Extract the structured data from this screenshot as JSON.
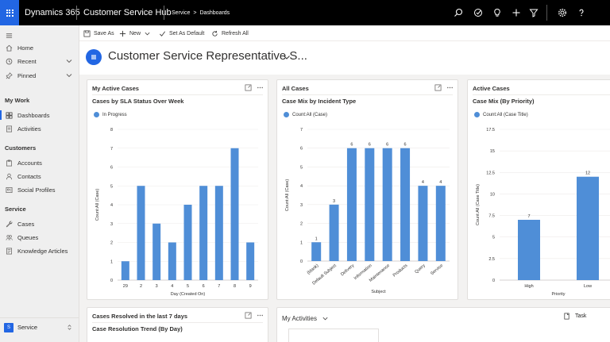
{
  "topbar": {
    "brand": "Dynamics 365",
    "app_title": "Customer Service Hub",
    "breadcrumb": [
      "Service",
      "Dashboards"
    ],
    "icons": [
      "search-icon",
      "task-icon",
      "lightbulb-icon",
      "plus-icon",
      "filter-icon",
      "gear-icon",
      "help-icon"
    ]
  },
  "sidebar": {
    "items_top": [
      {
        "label": "Home",
        "icon": "home-icon"
      },
      {
        "label": "Recent",
        "icon": "clock-icon"
      },
      {
        "label": "Pinned",
        "icon": "pin-icon"
      }
    ],
    "groups": [
      {
        "title": "My Work",
        "items": [
          {
            "label": "Dashboards",
            "icon": "dashboard-icon"
          },
          {
            "label": "Activities",
            "icon": "activities-icon"
          }
        ]
      },
      {
        "title": "Customers",
        "items": [
          {
            "label": "Accounts",
            "icon": "accounts-icon"
          },
          {
            "label": "Contacts",
            "icon": "contact-icon"
          },
          {
            "label": "Social Profiles",
            "icon": "social-icon"
          }
        ]
      },
      {
        "title": "Service",
        "items": [
          {
            "label": "Cases",
            "icon": "wrench-icon"
          },
          {
            "label": "Queues",
            "icon": "queue-icon"
          },
          {
            "label": "Knowledge Articles",
            "icon": "article-icon"
          }
        ]
      }
    ],
    "area": {
      "badge": "S",
      "label": "Service"
    }
  },
  "commands": {
    "save_as": "Save As",
    "new": "New",
    "set_default": "Set As Default",
    "refresh": "Refresh All"
  },
  "dashboard": {
    "title": "Customer Service Representative S..."
  },
  "cards": {
    "c1": {
      "title": "My Active Cases",
      "subtitle": "Cases by SLA Status Over Week",
      "legend": "In Progress"
    },
    "c2": {
      "title": "All Cases",
      "subtitle": "Case Mix by Incident Type",
      "legend": "Count:All (Case)"
    },
    "c3": {
      "title": "Active Cases",
      "subtitle": "Case Mix (By Priority)",
      "legend": "Count:All (Case Title)"
    },
    "c4": {
      "title": "Cases Resolved in the last 7 days",
      "subtitle": "Case Resolution Trend (By Day)"
    },
    "c5": {
      "title": "My Activities",
      "task_label": "Task"
    }
  },
  "colors": {
    "accent": "#2266e3",
    "bar": "#4f8ed7"
  },
  "chart_data": [
    {
      "type": "bar",
      "categories": [
        "29",
        "2",
        "3",
        "4",
        "5",
        "6",
        "7",
        "8",
        "9"
      ],
      "values": [
        1,
        5,
        3,
        2,
        4,
        5,
        5,
        7,
        2
      ],
      "xlabel": "Day (Created On)",
      "ylabel": "Count:All (Case)",
      "ylim": [
        0,
        8
      ],
      "yticks": [
        0,
        1,
        2,
        3,
        4,
        5,
        6,
        7,
        8
      ],
      "legend": "In Progress",
      "data_labels": false
    },
    {
      "type": "bar",
      "categories": [
        "(blank)",
        "Default Subject",
        "Delivery",
        "Information",
        "Maintenance",
        "Products",
        "Query",
        "Service"
      ],
      "values": [
        1,
        3,
        6,
        6,
        6,
        6,
        4,
        4
      ],
      "xlabel": "Subject",
      "ylabel": "Count:All (Case)",
      "ylim": [
        0,
        7
      ],
      "yticks": [
        0,
        1,
        2,
        3,
        4,
        5,
        6,
        7
      ],
      "legend": "Count:All (Case)",
      "data_labels": true
    },
    {
      "type": "bar",
      "categories": [
        "High",
        "Low"
      ],
      "values": [
        7,
        12
      ],
      "xlabel": "Priority",
      "ylabel": "Count:All (Case Title)",
      "ylim": [
        0,
        17.5
      ],
      "yticks": [
        0,
        2.5,
        5,
        7.5,
        10,
        12.5,
        15,
        17.5
      ],
      "legend": "Count:All (Case Title)",
      "data_labels": true
    }
  ]
}
